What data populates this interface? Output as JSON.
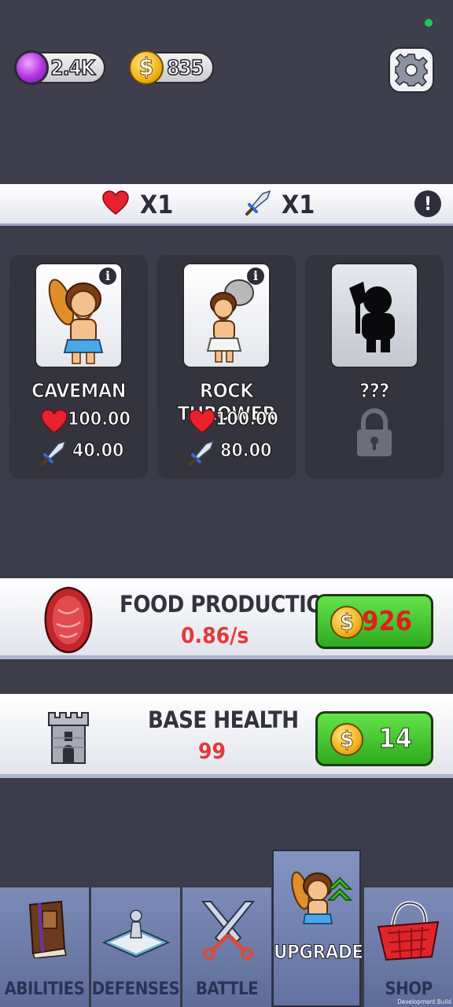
{
  "currency": {
    "gems": "2.4K",
    "coins": "835",
    "coin_symbol": "$"
  },
  "settings": {
    "icon": "gear-icon"
  },
  "army_stats": {
    "health_mult": "X1",
    "attack_mult": "X1",
    "info_symbol": "!"
  },
  "units": [
    {
      "name": "CAVEMAN",
      "health": "100.00",
      "attack": "40.00",
      "info": "i"
    },
    {
      "name": "ROCK THROWER",
      "health": "100.00",
      "attack": "80.00",
      "info": "i"
    },
    {
      "name": "???",
      "locked": true
    }
  ],
  "upgrades": {
    "food": {
      "title": "FOOD PRODUCTION",
      "value": "0.86/s",
      "price": "926",
      "price_color": "#e11d1d"
    },
    "base": {
      "title": "BASE HEALTH",
      "value": "99",
      "price": "14",
      "price_color": "#ffffff"
    }
  },
  "nav": {
    "tabs": [
      {
        "label": "ABILITIES"
      },
      {
        "label": "DEFENSES"
      },
      {
        "label": "BATTLE"
      },
      {
        "label": "UPGRADE",
        "active": true
      },
      {
        "label": "SHOP"
      }
    ]
  },
  "build_label": "Development Build",
  "colors": {
    "background": "#3c3c4a",
    "accent_green": "#3fbf2a",
    "stat_red": "#e23a3a",
    "tab_blue": "#6e7ead"
  }
}
